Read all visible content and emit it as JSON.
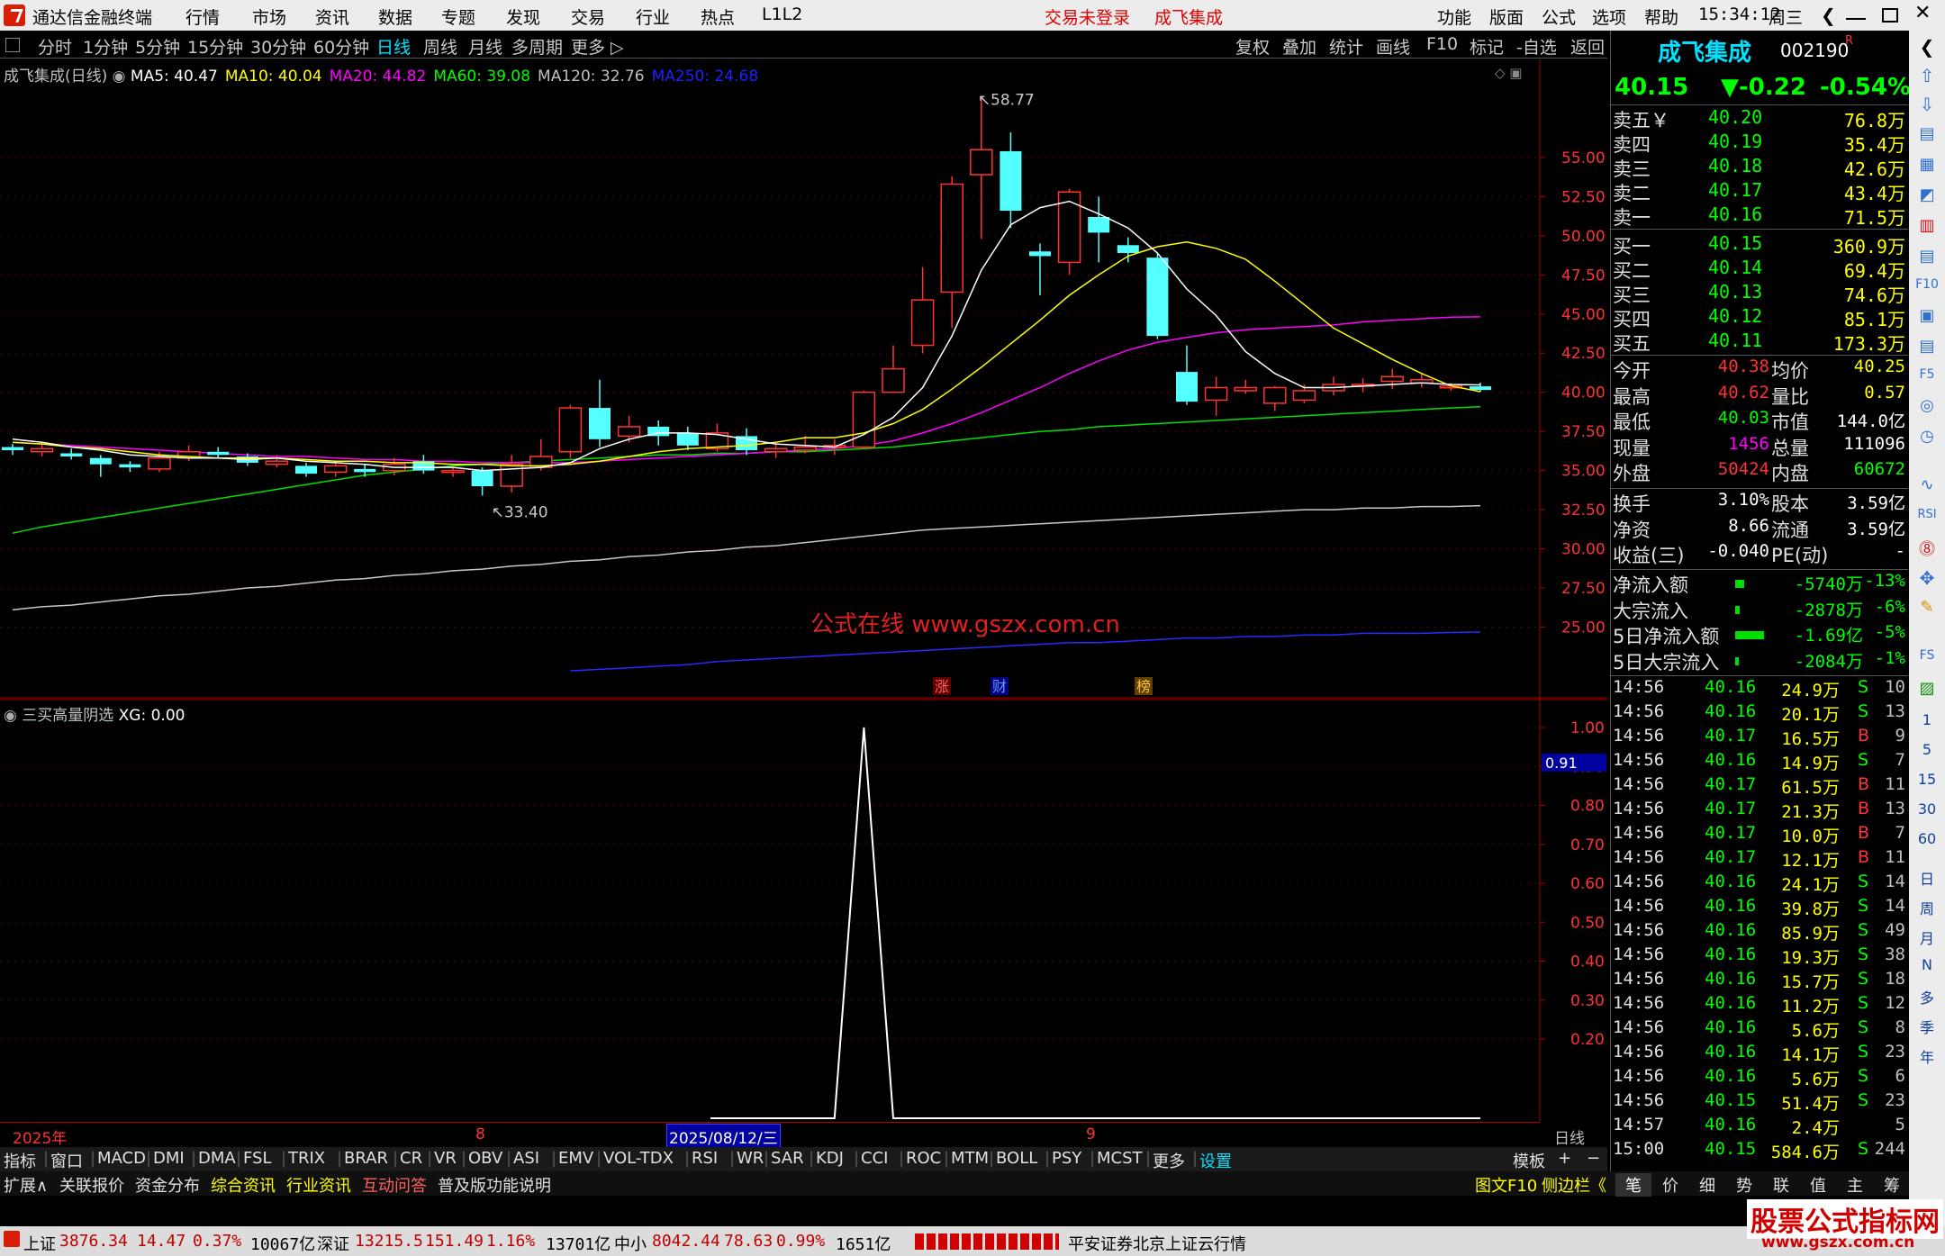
{
  "titlebar": {
    "app_name": "通达信金融终端",
    "menu": [
      "行情",
      "市场",
      "资讯",
      "数据",
      "专题",
      "发现",
      "交易",
      "行业",
      "热点",
      "L1L2"
    ],
    "login_status": "交易未登录",
    "stock_name": "成飞集成",
    "right_menu": [
      "功能",
      "版面",
      "公式",
      "选项",
      "帮助"
    ],
    "clock": "15:34:12",
    "weekday": "周三"
  },
  "periods": [
    "分时",
    "1分钟",
    "5分钟",
    "15分钟",
    "30分钟",
    "60分钟",
    "日线",
    "周线",
    "月线",
    "多周期",
    "更多 ▷"
  ],
  "active_period": "日线",
  "toolbar_right": [
    "复权",
    "叠加",
    "统计",
    "画线",
    "F10",
    "标记",
    "-自选",
    "返回"
  ],
  "main_chart": {
    "legend_title": "成飞集成(日线)",
    "ma": [
      {
        "label": "MA5: 40.47",
        "color": "#ffffff"
      },
      {
        "label": "MA10: 40.04",
        "color": "#ffff00"
      },
      {
        "label": "MA20: 44.82",
        "color": "#ff00ff"
      },
      {
        "label": "MA60: 39.08",
        "color": "#00ff00"
      },
      {
        "label": "MA120: 32.76",
        "color": "#c0c0c0"
      },
      {
        "label": "MA250: 24.68",
        "color": "#2020ff"
      }
    ],
    "high_label": "58.77",
    "low_label": "33.40",
    "watermark": "公式在线  www.gszx.com.cn",
    "markers": [
      "涨",
      "财",
      "榜"
    ]
  },
  "chart_data": {
    "type": "candlestick",
    "y_ticks": [
      "55.00",
      "52.50",
      "50.00",
      "47.50",
      "45.00",
      "42.50",
      "40.00",
      "37.50",
      "35.00",
      "32.50",
      "30.00",
      "27.50",
      "25.00"
    ],
    "ylim": [
      21.0,
      60.0
    ],
    "candles": [
      [
        36.5,
        36.3,
        36.7,
        36.0
      ],
      [
        36.2,
        36.4,
        36.8,
        35.9
      ],
      [
        36.1,
        35.9,
        36.4,
        35.7
      ],
      [
        35.8,
        35.4,
        36.0,
        34.6
      ],
      [
        35.4,
        35.2,
        35.6,
        34.9
      ],
      [
        35.1,
        35.8,
        36.2,
        34.9
      ],
      [
        35.8,
        36.2,
        36.6,
        35.6
      ],
      [
        36.2,
        36.0,
        36.5,
        35.8
      ],
      [
        35.9,
        35.5,
        36.1,
        35.3
      ],
      [
        35.4,
        35.6,
        36.0,
        35.2
      ],
      [
        35.3,
        34.8,
        35.5,
        34.6
      ],
      [
        34.9,
        35.3,
        35.6,
        34.6
      ],
      [
        35.1,
        34.9,
        35.4,
        34.6
      ],
      [
        35.0,
        35.4,
        35.8,
        34.7
      ],
      [
        35.6,
        35.0,
        36.0,
        34.8
      ],
      [
        34.9,
        35.0,
        35.2,
        34.6
      ],
      [
        35.0,
        34.0,
        35.2,
        33.4
      ],
      [
        34.0,
        35.4,
        36.0,
        33.6
      ],
      [
        35.2,
        35.9,
        37.0,
        35.0
      ],
      [
        36.2,
        39.0,
        39.2,
        35.8
      ],
      [
        39.0,
        37.0,
        40.8,
        36.5
      ],
      [
        37.2,
        37.8,
        38.5,
        36.8
      ],
      [
        37.8,
        37.2,
        38.2,
        36.6
      ],
      [
        37.4,
        36.6,
        37.8,
        36.3
      ],
      [
        36.4,
        37.4,
        38.0,
        36.2
      ],
      [
        37.2,
        36.3,
        37.7,
        36.0
      ],
      [
        36.2,
        36.4,
        36.8,
        35.8
      ],
      [
        36.3,
        36.5,
        37.2,
        36.1
      ],
      [
        36.5,
        36.6,
        37.0,
        36.0
      ],
      [
        36.5,
        40.0,
        40.1,
        36.4
      ],
      [
        40.0,
        41.5,
        43.0,
        40.4
      ],
      [
        43.0,
        45.9,
        48.0,
        42.5
      ],
      [
        46.4,
        53.3,
        53.8,
        44.1
      ],
      [
        53.9,
        55.5,
        58.77,
        49.8
      ],
      [
        55.4,
        51.6,
        56.6,
        50.5
      ],
      [
        49.0,
        48.7,
        49.5,
        46.2
      ],
      [
        48.3,
        52.8,
        53.0,
        47.5
      ],
      [
        51.2,
        50.2,
        52.5,
        48.3
      ],
      [
        49.4,
        48.9,
        49.9,
        48.3
      ],
      [
        48.6,
        43.6,
        48.9,
        43.4
      ],
      [
        41.3,
        39.4,
        43.0,
        39.2
      ],
      [
        39.5,
        40.3,
        41.0,
        38.5
      ],
      [
        40.1,
        40.3,
        40.8,
        39.9
      ],
      [
        39.3,
        40.3,
        40.4,
        38.8
      ],
      [
        39.5,
        40.1,
        40.5,
        39.3
      ],
      [
        40.1,
        40.5,
        41.0,
        39.8
      ],
      [
        40.4,
        40.5,
        40.9,
        40.0
      ],
      [
        40.7,
        41.0,
        41.5,
        40.2
      ],
      [
        40.6,
        40.8,
        41.2,
        40.3
      ],
      [
        40.4,
        40.4,
        40.6,
        40.1
      ],
      [
        40.38,
        40.15,
        40.62,
        40.03
      ]
    ],
    "ma5": [
      37.0,
      36.8,
      36.5,
      36.3,
      36.0,
      35.9,
      35.8,
      35.8,
      35.7,
      35.8,
      35.6,
      35.5,
      35.4,
      35.2,
      35.2,
      35.2,
      35.0,
      35.1,
      35.2,
      35.5,
      36.4,
      37.0,
      37.4,
      37.4,
      37.3,
      37.0,
      36.7,
      36.6,
      36.5,
      37.3,
      38.4,
      40.3,
      43.6,
      47.8,
      50.7,
      51.8,
      52.2,
      51.4,
      50.5,
      48.9,
      46.6,
      44.9,
      42.6,
      41.2,
      40.3,
      40.3,
      40.4,
      40.5,
      40.6,
      40.5,
      40.47
    ],
    "ma10": [
      36.8,
      36.7,
      36.5,
      36.4,
      36.2,
      36.0,
      35.9,
      35.8,
      35.8,
      35.8,
      35.7,
      35.6,
      35.6,
      35.5,
      35.5,
      35.4,
      35.4,
      35.3,
      35.3,
      35.4,
      35.6,
      35.9,
      36.2,
      36.4,
      36.5,
      36.6,
      36.8,
      37.1,
      37.1,
      37.4,
      38.0,
      38.9,
      40.2,
      41.6,
      43.1,
      44.6,
      46.2,
      47.5,
      48.7,
      49.3,
      49.6,
      49.2,
      48.5,
      47.1,
      45.6,
      44.1,
      43.1,
      42.1,
      41.2,
      40.4,
      40.04
    ],
    "ma20": [
      36.8,
      36.7,
      36.6,
      36.5,
      36.4,
      36.3,
      36.2,
      36.1,
      36.0,
      35.9,
      35.9,
      35.8,
      35.7,
      35.7,
      35.6,
      35.6,
      35.5,
      35.5,
      35.5,
      35.5,
      35.6,
      35.7,
      35.8,
      35.9,
      36.0,
      36.1,
      36.2,
      36.3,
      36.4,
      36.6,
      36.9,
      37.4,
      38.0,
      38.7,
      39.5,
      40.3,
      41.2,
      42.0,
      42.7,
      43.2,
      43.5,
      43.8,
      44.0,
      44.1,
      44.2,
      44.3,
      44.5,
      44.6,
      44.7,
      44.8,
      44.82
    ],
    "ma60": [
      31.0,
      31.4,
      31.7,
      32.0,
      32.3,
      32.6,
      32.9,
      33.2,
      33.5,
      33.8,
      34.1,
      34.4,
      34.7,
      34.9,
      35.1,
      35.3,
      35.4,
      35.5,
      35.6,
      35.7,
      35.8,
      35.9,
      36.0,
      36.0,
      36.1,
      36.1,
      36.2,
      36.2,
      36.3,
      36.4,
      36.5,
      36.7,
      36.9,
      37.1,
      37.3,
      37.5,
      37.6,
      37.8,
      37.9,
      38.0,
      38.1,
      38.2,
      38.3,
      38.4,
      38.5,
      38.6,
      38.7,
      38.8,
      38.9,
      39.0,
      39.08
    ],
    "ma120": [
      26.1,
      26.3,
      26.4,
      26.6,
      26.8,
      27.0,
      27.1,
      27.3,
      27.5,
      27.6,
      27.8,
      28.0,
      28.1,
      28.3,
      28.4,
      28.6,
      28.7,
      28.9,
      29.0,
      29.2,
      29.3,
      29.5,
      29.6,
      29.8,
      29.9,
      30.1,
      30.2,
      30.4,
      30.6,
      30.8,
      31.0,
      31.2,
      31.3,
      31.4,
      31.5,
      31.6,
      31.7,
      31.8,
      31.9,
      32.0,
      32.1,
      32.2,
      32.3,
      32.4,
      32.5,
      32.5,
      32.6,
      32.6,
      32.7,
      32.7,
      32.76
    ],
    "ma250_start_index": 19,
    "ma250": [
      22.2,
      22.3,
      22.4,
      22.5,
      22.6,
      22.8,
      22.9,
      23.0,
      23.1,
      23.2,
      23.3,
      23.4,
      23.5,
      23.6,
      23.7,
      23.8,
      23.9,
      24.0,
      24.0,
      24.1,
      24.2,
      24.3,
      24.3,
      24.4,
      24.4,
      24.5,
      24.5,
      24.6,
      24.6,
      24.6,
      24.65,
      24.68
    ]
  },
  "sub_chart": {
    "title": "三买高量阴选",
    "value_label": "XG: 0.00",
    "y_ticks": [
      "1.00",
      "0.90",
      "0.80",
      "0.70",
      "0.60",
      "0.50",
      "0.40",
      "0.30",
      "0.20"
    ],
    "cursor_value": "0.91",
    "signal": [
      0,
      0,
      0,
      0,
      0,
      0,
      0,
      0,
      0,
      0,
      0,
      0,
      0,
      0,
      0,
      0,
      0,
      0,
      0,
      0,
      0,
      0,
      0,
      0,
      0,
      0,
      0,
      0,
      0,
      0,
      0,
      0,
      0,
      0,
      0,
      0,
      0,
      0,
      0,
      0,
      0,
      0,
      0,
      0,
      0,
      0,
      0,
      0,
      0,
      0,
      0
    ],
    "signal_start_index": 25,
    "signal_values": [
      0,
      0,
      0,
      0,
      1,
      0,
      0,
      0,
      0,
      0,
      0,
      0,
      0,
      0,
      0,
      0,
      0,
      0,
      0,
      0,
      0,
      0,
      0,
      0,
      0,
      0
    ]
  },
  "xaxis": {
    "year": "2025年",
    "m8": "8",
    "date": "2025/08/12/三",
    "m9": "9",
    "period": "日线"
  },
  "indicators": [
    "指标",
    "窗口",
    "MACD",
    "DMI",
    "DMA",
    "FSL",
    "TRIX",
    "BRAR",
    "CR",
    "VR",
    "OBV",
    "ASI",
    "EMV",
    "VOL-TDX",
    "RSI",
    "WR",
    "SAR",
    "KDJ",
    "CCI",
    "ROC",
    "MTM",
    "BOLL",
    "PSY",
    "MCST",
    "更多",
    "设置"
  ],
  "template_label": "模板",
  "bottom_tabs": [
    "扩展∧",
    "关联报价",
    "资金分布",
    "综合资讯",
    "行业资讯",
    "互动问答",
    "普及版功能说明"
  ],
  "bottom_right": [
    "图文F10",
    "侧边栏《"
  ],
  "panel_tabs": [
    "笔",
    "价",
    "细",
    "势",
    "联",
    "值",
    "主",
    "筹"
  ],
  "quote": {
    "name": "成飞集成",
    "code": "002190",
    "tag": "R",
    "price": "40.15",
    "change": "▼-0.22",
    "pct": "-0.54%",
    "sells": [
      {
        "label": "卖五￥",
        "price": "40.20",
        "vol": "76.8万"
      },
      {
        "label": "卖四",
        "price": "40.19",
        "vol": "35.4万"
      },
      {
        "label": "卖三",
        "price": "40.18",
        "vol": "42.6万"
      },
      {
        "label": "卖二",
        "price": "40.17",
        "vol": "43.4万"
      },
      {
        "label": "卖一",
        "price": "40.16",
        "vol": "71.5万"
      }
    ],
    "buys": [
      {
        "label": "买一",
        "price": "40.15",
        "vol": "360.9万"
      },
      {
        "label": "买二",
        "price": "40.14",
        "vol": "69.4万"
      },
      {
        "label": "买三",
        "price": "40.13",
        "vol": "74.6万"
      },
      {
        "label": "买四",
        "price": "40.12",
        "vol": "85.1万"
      },
      {
        "label": "买五",
        "price": "40.11",
        "vol": "173.3万"
      }
    ],
    "stats": [
      {
        "l1": "今开",
        "v1": "40.38",
        "c1": "#ff3232",
        "l2": "均价",
        "v2": "40.25",
        "c2": "#ffff00"
      },
      {
        "l1": "最高",
        "v1": "40.62",
        "c1": "#ff3232",
        "l2": "量比",
        "v2": "0.57",
        "c2": "#ffff00"
      },
      {
        "l1": "最低",
        "v1": "40.03",
        "c1": "#00ff00",
        "l2": "市值",
        "v2": "144.0亿",
        "c2": "#ffffff"
      },
      {
        "l1": "现量",
        "v1": "1456",
        "c1": "#ff00ff",
        "l2": "总量",
        "v2": "111096",
        "c2": "#ffffff"
      },
      {
        "l1": "外盘",
        "v1": "50424",
        "c1": "#ff3232",
        "l2": "内盘",
        "v2": "60672",
        "c2": "#00ff00"
      }
    ],
    "stats2": [
      {
        "l1": "换手",
        "v1": "3.10%",
        "l2": "股本",
        "v2": "3.59亿"
      },
      {
        "l1": "净资",
        "v1": "8.66",
        "l2": "流通",
        "v2": "3.59亿"
      },
      {
        "l1": "收益(三)",
        "v1": "-0.040",
        "l2": "PE(动)",
        "v2": "-"
      }
    ],
    "flows": [
      {
        "label": "净流入额",
        "value": "-5740万",
        "pct": "-13%",
        "bar": 0.13
      },
      {
        "label": "大宗流入",
        "value": "-2878万",
        "pct": "-6%",
        "bar": 0.06
      },
      {
        "label": "5日净流入额",
        "value": "-1.69亿",
        "pct": "-5%",
        "bar": 0.4
      },
      {
        "label": "5日大宗流入",
        "value": "-2084万",
        "pct": "-1%",
        "bar": 0.02
      }
    ],
    "ticks": [
      {
        "t": "14:56",
        "p": "40.16",
        "v": "24.9万",
        "bs": "S",
        "n": "10"
      },
      {
        "t": "14:56",
        "p": "40.16",
        "v": "20.1万",
        "bs": "S",
        "n": "13"
      },
      {
        "t": "14:56",
        "p": "40.17",
        "v": "16.5万",
        "bs": "B",
        "n": "9"
      },
      {
        "t": "14:56",
        "p": "40.16",
        "v": "14.9万",
        "bs": "S",
        "n": "7"
      },
      {
        "t": "14:56",
        "p": "40.17",
        "v": "61.5万",
        "bs": "B",
        "n": "11"
      },
      {
        "t": "14:56",
        "p": "40.17",
        "v": "21.3万",
        "bs": "B",
        "n": "13"
      },
      {
        "t": "14:56",
        "p": "40.17",
        "v": "10.0万",
        "bs": "B",
        "n": "7"
      },
      {
        "t": "14:56",
        "p": "40.17",
        "v": "12.1万",
        "bs": "B",
        "n": "11"
      },
      {
        "t": "14:56",
        "p": "40.16",
        "v": "24.1万",
        "bs": "S",
        "n": "14"
      },
      {
        "t": "14:56",
        "p": "40.16",
        "v": "39.8万",
        "bs": "S",
        "n": "14"
      },
      {
        "t": "14:56",
        "p": "40.16",
        "v": "85.9万",
        "bs": "S",
        "n": "49"
      },
      {
        "t": "14:56",
        "p": "40.16",
        "v": "19.3万",
        "bs": "S",
        "n": "38"
      },
      {
        "t": "14:56",
        "p": "40.16",
        "v": "15.7万",
        "bs": "S",
        "n": "18"
      },
      {
        "t": "14:56",
        "p": "40.16",
        "v": "11.2万",
        "bs": "S",
        "n": "12"
      },
      {
        "t": "14:56",
        "p": "40.16",
        "v": "5.6万",
        "bs": "S",
        "n": "8"
      },
      {
        "t": "14:56",
        "p": "40.16",
        "v": "14.1万",
        "bs": "S",
        "n": "23"
      },
      {
        "t": "14:56",
        "p": "40.16",
        "v": "5.6万",
        "bs": "S",
        "n": "6"
      },
      {
        "t": "14:56",
        "p": "40.15",
        "v": "51.4万",
        "bs": "S",
        "n": "23"
      },
      {
        "t": "14:57",
        "p": "40.16",
        "v": "2.4万",
        "bs": "",
        "n": "5"
      },
      {
        "t": "15:00",
        "p": "40.15",
        "v": "584.6万",
        "bs": "S",
        "n": "244"
      }
    ]
  },
  "status": {
    "sh_name": "上证",
    "sh_val": "3876.34",
    "sh_chg": "14.47",
    "sh_pct": "0.37%",
    "sh_amt": "10067亿",
    "sz_name": "深证",
    "sz_val": "13215.5",
    "sz_chg": "151.49",
    "sz_pct": "1.16%",
    "sz_amt": "13701亿",
    "zx_name": "中小",
    "zx_val": "8042.44",
    "zx_chg": "78.63",
    "zx_pct": "0.99%",
    "zx_amt": "1651亿",
    "server": "平安证券北京上证云行情",
    "brand": "股票公式指标网",
    "brand_url": "www.gszx.com.cn"
  },
  "sidebar_items": [
    "1",
    "5",
    "15",
    "30",
    "60",
    "日",
    "周",
    "月",
    "N",
    "多",
    "季",
    "年"
  ]
}
